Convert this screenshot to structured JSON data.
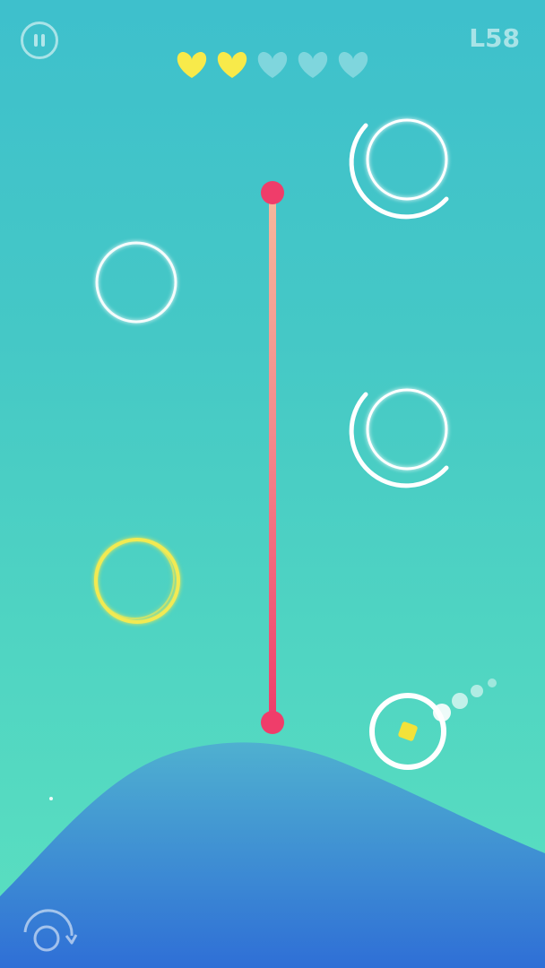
{
  "hud": {
    "level_label": "L58",
    "pause_icon": "pause-icon",
    "restart_icon": "restart-icon",
    "lives_total": 5,
    "lives_filled": 2
  },
  "colors": {
    "heart_filled": "#f8ea4a",
    "heart_empty": "#7fd6dd",
    "laser_end": "#ef3d6a",
    "laser_top": "#f6b49c",
    "ring": "#ffffff",
    "target_ring": "#f2ea52",
    "ball_core": "#f2e23a",
    "hill_top": "#4aa9cf",
    "hill_bottom": "#2f6fd6"
  }
}
